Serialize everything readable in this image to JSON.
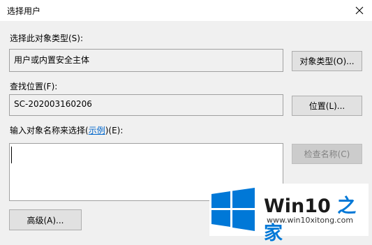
{
  "window": {
    "title": "选择用户"
  },
  "object_type": {
    "label": "选择此对象类型(S):",
    "value": "用户或内置安全主体",
    "button": "对象类型(O)..."
  },
  "location": {
    "label": "查找位置(F):",
    "value": "SC-202003160206",
    "button": "位置(L)..."
  },
  "names": {
    "label_prefix": "输入对象名称来选择(",
    "label_link": "示例",
    "label_suffix": ")(E):",
    "value": "",
    "check_button": "检查名称(C)"
  },
  "advanced_button": "高级(A)...",
  "watermark": {
    "brand_part1": "Win10 ",
    "brand_part2": "之家",
    "url": "www.win10xitong.com"
  },
  "colors": {
    "link": "#0066cc",
    "win_blue": "#0078d7"
  }
}
